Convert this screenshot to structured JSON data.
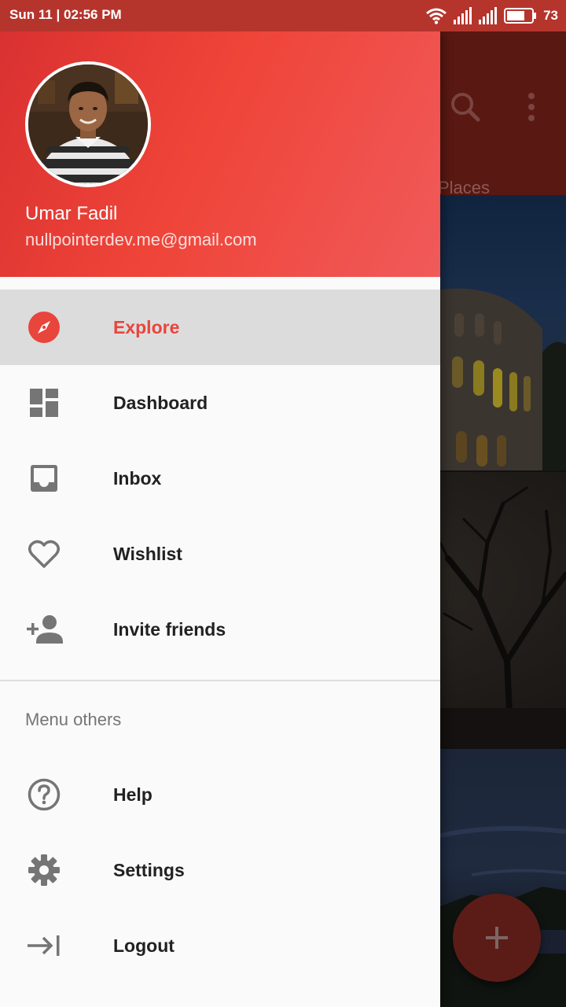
{
  "status_bar": {
    "time": "Sun 11 | 02:56 PM",
    "battery": "73",
    "icons": [
      "wifi-icon",
      "signal-icon",
      "signal-icon",
      "battery-icon"
    ]
  },
  "background_app": {
    "tab_places": "Places",
    "icons": [
      "search-icon",
      "more-vert-icon",
      "add-icon"
    ]
  },
  "drawer": {
    "header": {
      "name": "Umar Fadil",
      "email": "nullpointerdev.me@gmail.com"
    },
    "items": [
      {
        "label": "Explore",
        "icon": "compass-icon",
        "active": true
      },
      {
        "label": "Dashboard",
        "icon": "dashboard-icon"
      },
      {
        "label": "Inbox",
        "icon": "inbox-icon"
      },
      {
        "label": "Wishlist",
        "icon": "heart-icon"
      },
      {
        "label": "Invite friends",
        "icon": "person-add-icon"
      }
    ],
    "section_title": "Menu others",
    "other_items": [
      {
        "label": "Help",
        "icon": "help-icon"
      },
      {
        "label": "Settings",
        "icon": "settings-icon"
      },
      {
        "label": "Logout",
        "icon": "logout-icon"
      }
    ]
  },
  "colors": {
    "accent": "#e8453c",
    "status_bar": "#b5352d",
    "active_item_bg": "#dcdcdc"
  }
}
